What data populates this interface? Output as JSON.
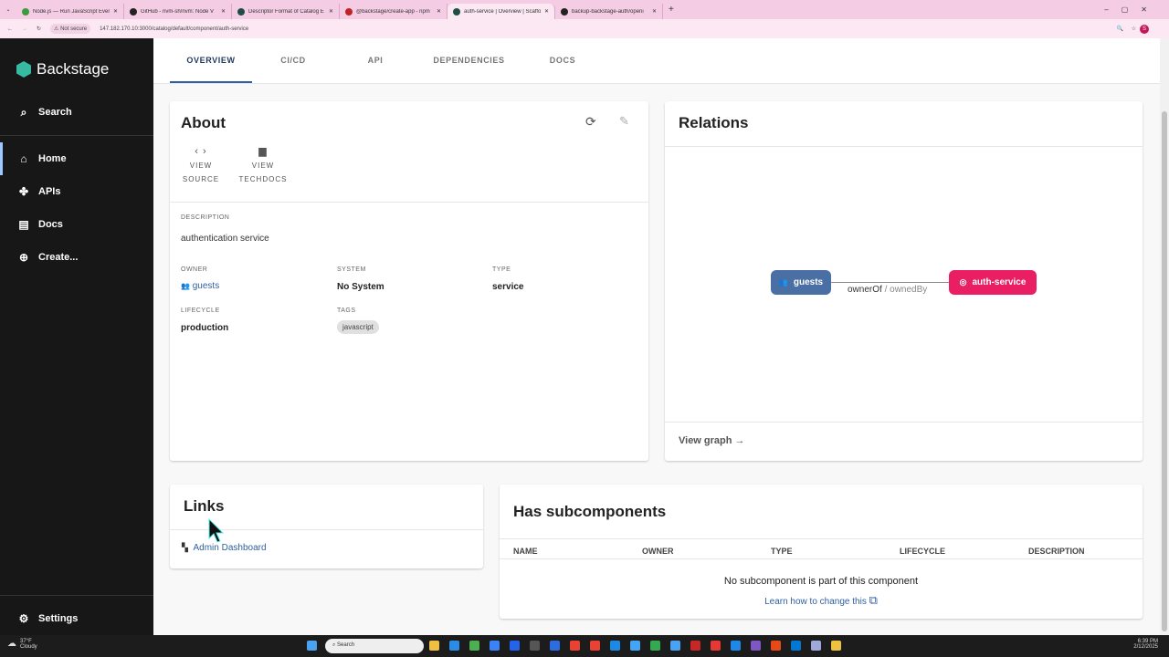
{
  "browser": {
    "tabs": [
      {
        "title": "Node.js — Run JavaScript Ever",
        "color": "#3c9b3c"
      },
      {
        "title": "GitHub - nvm-sh/nvm: Node V",
        "color": "#222"
      },
      {
        "title": "Descriptor Format of Catalog E",
        "color": "#1e4d45"
      },
      {
        "title": "@backstage/create-app - npm",
        "color": "#c12127"
      },
      {
        "title": "auth-service | Overview | Scaffo",
        "color": "#1e4d45",
        "active": true
      },
      {
        "title": "backup-backstage-auth/openi",
        "color": "#222"
      }
    ],
    "security": "Not secure",
    "url": "147.182.170.10:3000/catalog/default/component/auth-service"
  },
  "sidebar": {
    "brand": "Backstage",
    "search": "Search",
    "items": [
      {
        "label": "Home",
        "icon": "home-icon"
      },
      {
        "label": "APIs",
        "icon": "puzzle-icon"
      },
      {
        "label": "Docs",
        "icon": "docs-icon"
      },
      {
        "label": "Create...",
        "icon": "add-circle-icon"
      }
    ],
    "settings": "Settings"
  },
  "page_tabs": [
    "OVERVIEW",
    "CI/CD",
    "API",
    "DEPENDENCIES",
    "DOCS"
  ],
  "about": {
    "title": "About",
    "view_source": [
      "VIEW",
      "SOURCE"
    ],
    "view_techdocs": [
      "VIEW",
      "TECHDOCS"
    ],
    "description_label": "DESCRIPTION",
    "description": "authentication service",
    "owner_label": "OWNER",
    "owner": "guests",
    "system_label": "SYSTEM",
    "system": "No System",
    "type_label": "TYPE",
    "type": "service",
    "lifecycle_label": "LIFECYCLE",
    "lifecycle": "production",
    "tags_label": "TAGS",
    "tags": [
      "javascript"
    ]
  },
  "relations": {
    "title": "Relations",
    "source": "guests",
    "target": "auth-service",
    "edge_primary": "ownerOf",
    "edge_secondary": "/ ownedBy",
    "view_graph": "View graph",
    "source_color": "#4a6fa5",
    "target_color": "#e91e63"
  },
  "links": {
    "title": "Links",
    "items": [
      {
        "label": "Admin Dashboard"
      }
    ]
  },
  "subcomponents": {
    "title": "Has subcomponents",
    "columns": [
      "NAME",
      "OWNER",
      "TYPE",
      "LIFECYCLE",
      "DESCRIPTION"
    ],
    "empty": "No subcomponent is part of this component",
    "learn": "Learn how to change this"
  },
  "taskbar": {
    "weather_temp": "37°F",
    "weather_desc": "Cloudy",
    "search": "Search",
    "time": "6:39 PM",
    "date": "2/12/2025"
  }
}
